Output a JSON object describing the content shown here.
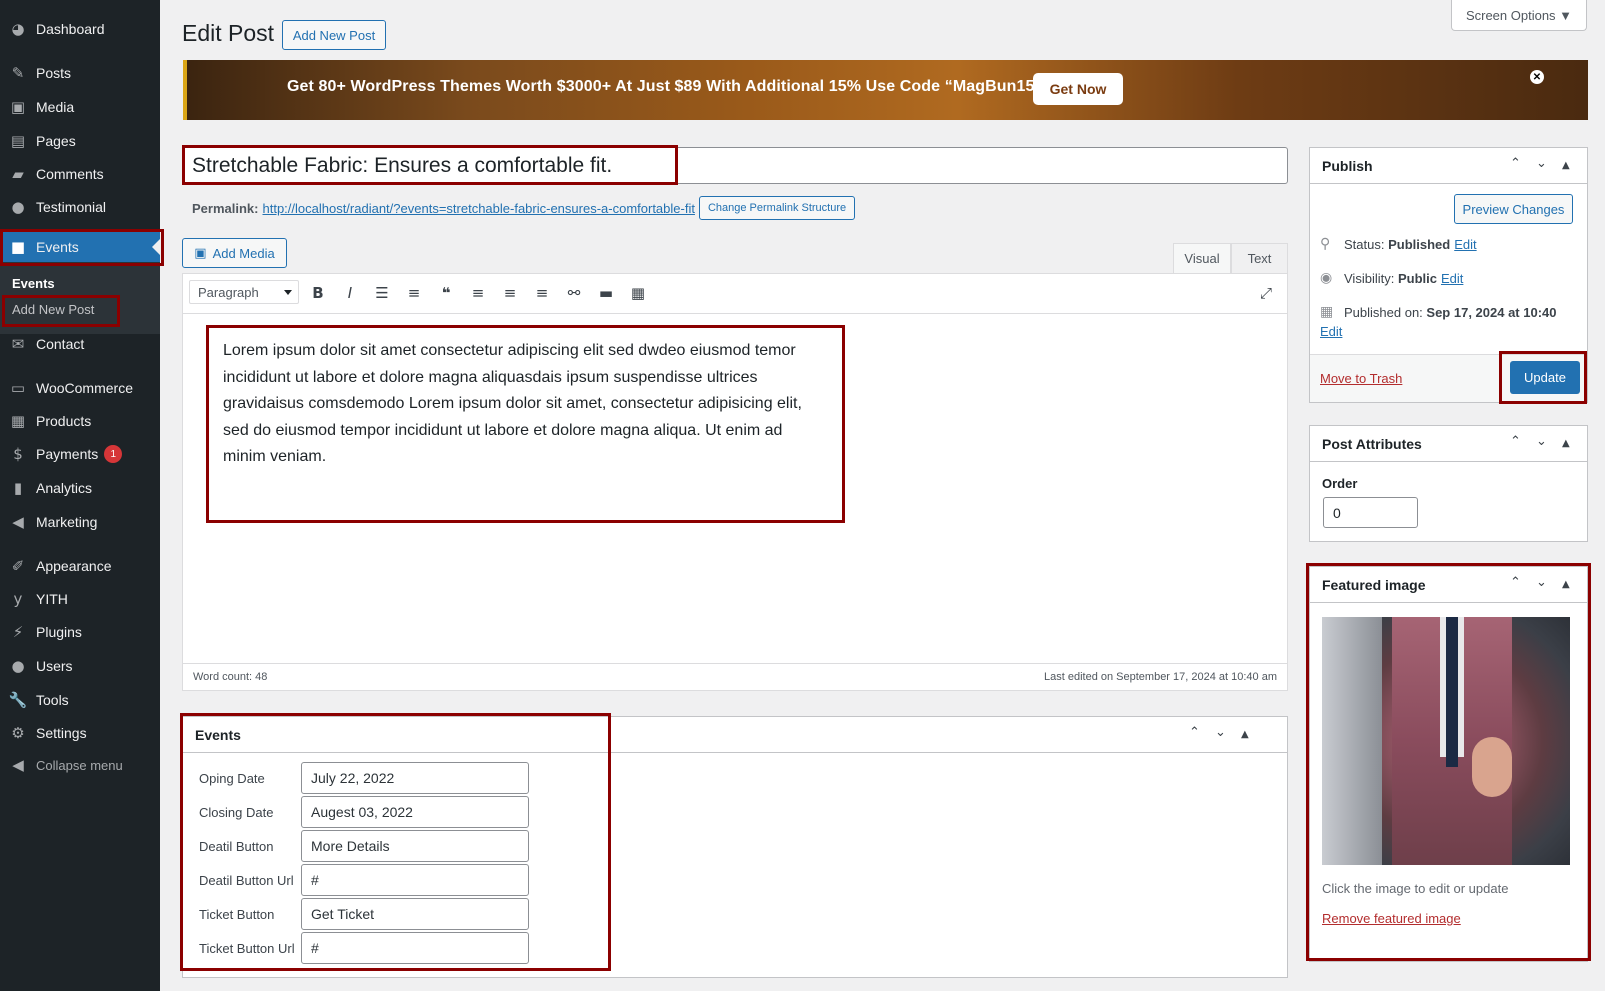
{
  "sidebar": {
    "items": [
      {
        "label": "Dashboard",
        "icon": "dashboard-icon",
        "glyph": "◕"
      },
      {
        "label": "Posts",
        "icon": "pin-icon",
        "glyph": "✎"
      },
      {
        "label": "Media",
        "icon": "media-icon",
        "glyph": "▣"
      },
      {
        "label": "Pages",
        "icon": "pages-icon",
        "glyph": "▤"
      },
      {
        "label": "Comments",
        "icon": "comment-icon",
        "glyph": "▰"
      },
      {
        "label": "Testimonial",
        "icon": "user-icon",
        "glyph": "●"
      },
      {
        "label": "Events",
        "icon": "video-icon",
        "glyph": "■"
      },
      {
        "label": "Contact",
        "icon": "mail-icon",
        "glyph": "✉"
      },
      {
        "label": "WooCommerce",
        "icon": "woo-icon",
        "glyph": "▭"
      },
      {
        "label": "Products",
        "icon": "archive-icon",
        "glyph": "▦"
      },
      {
        "label": "Payments",
        "icon": "dollar-icon",
        "glyph": "$",
        "badge": "1"
      },
      {
        "label": "Analytics",
        "icon": "chart-icon",
        "glyph": "▮"
      },
      {
        "label": "Marketing",
        "icon": "megaphone-icon",
        "glyph": "◀"
      },
      {
        "label": "Appearance",
        "icon": "brush-icon",
        "glyph": "✐"
      },
      {
        "label": "YITH",
        "icon": "yith-icon",
        "glyph": "y"
      },
      {
        "label": "Plugins",
        "icon": "plugin-icon",
        "glyph": "⚡"
      },
      {
        "label": "Users",
        "icon": "users-icon",
        "glyph": "●"
      },
      {
        "label": "Tools",
        "icon": "wrench-icon",
        "glyph": "🔧"
      },
      {
        "label": "Settings",
        "icon": "settings-icon",
        "glyph": "⚙"
      },
      {
        "label": "Collapse menu",
        "icon": "collapse-icon",
        "glyph": "◀"
      }
    ],
    "submenu": {
      "heading": "Events",
      "add_new": "Add New Post"
    }
  },
  "header": {
    "title": "Edit Post",
    "add_new_button": "Add New Post",
    "screen_options": "Screen Options ▼"
  },
  "banner": {
    "text": "Get 80+ WordPress Themes Worth $3000+ At Just $89 With Additional 15% Use Code “MagBun15”",
    "button": "Get Now",
    "close": "✕"
  },
  "post": {
    "title": "Stretchable Fabric: Ensures a comfortable fit.",
    "permalink_label": "Permalink:",
    "permalink_url": "http://localhost/radiant/?events=stretchable-fabric-ensures-a-comfortable-fit",
    "change_permalink": "Change Permalink Structure",
    "add_media": "Add Media",
    "tabs": {
      "visual": "Visual",
      "text": "Text"
    },
    "format": "Paragraph",
    "content": "Lorem ipsum dolor sit amet consectetur adipiscing elit sed dwdeo eiusmod temor incididunt ut labore et dolore magna aliquasdais ipsum suspendisse ultrices gravidaisus comsdemodo Lorem ipsum dolor sit amet, consectetur adipisicing elit, sed do eiusmod tempor incididunt ut labore et dolore magna aliqua. Ut enim ad minim veniam.",
    "word_count": "Word count: 48",
    "last_edited": "Last edited on September 17, 2024 at 10:40 am"
  },
  "events_box": {
    "title": "Events",
    "fields": [
      {
        "label": "Oping Date",
        "value": "July 22, 2022"
      },
      {
        "label": "Closing Date",
        "value": "Augest 03, 2022"
      },
      {
        "label": "Deatil Button",
        "value": "More Details"
      },
      {
        "label": "Deatil Button Url",
        "value": "#"
      },
      {
        "label": "Ticket Button",
        "value": "Get Ticket"
      },
      {
        "label": "Ticket Button Url",
        "value": "#"
      }
    ]
  },
  "publish": {
    "title": "Publish",
    "preview": "Preview Changes",
    "status_label": "Status:",
    "status_value": "Published",
    "visibility_label": "Visibility:",
    "visibility_value": "Public",
    "published_label": "Published on:",
    "published_value": "Sep 17, 2024 at 10:40",
    "edit": "Edit",
    "trash": "Move to Trash",
    "update": "Update"
  },
  "attributes": {
    "title": "Post Attributes",
    "order_label": "Order",
    "order_value": "0"
  },
  "featured": {
    "title": "Featured image",
    "hint": "Click the image to edit or update",
    "remove": "Remove featured image"
  },
  "colors": {
    "accent": "#2271b1",
    "sidebar": "#1d2327",
    "highlight_box": "#8b0000"
  }
}
